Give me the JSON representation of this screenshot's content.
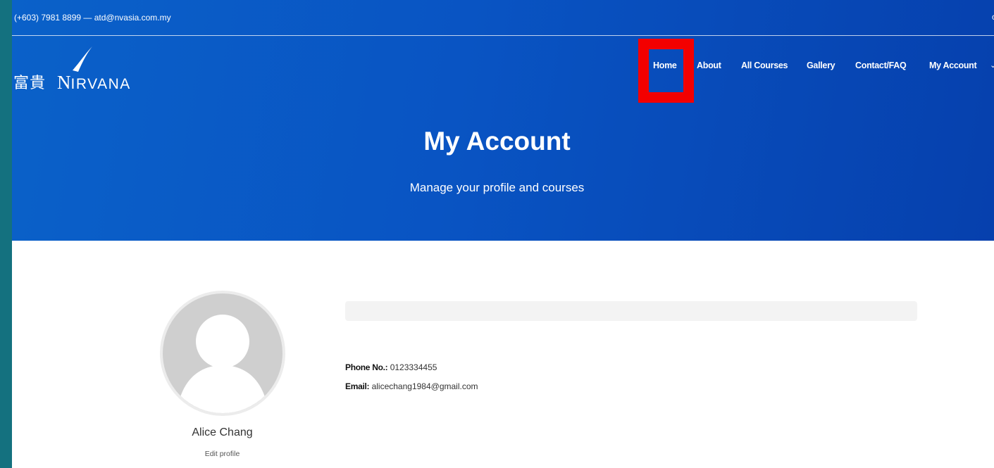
{
  "topbar": {
    "contact": "(+603) 7981 8899 — atd@nvasia.com.my"
  },
  "logo": {
    "cjk_text": "富貴",
    "initial": "N",
    "word_rest": "IRVANA"
  },
  "nav": {
    "items": [
      {
        "label": "Home"
      },
      {
        "label": "About"
      },
      {
        "label": "All Courses"
      },
      {
        "label": "Gallery"
      },
      {
        "label": "Contact/FAQ"
      },
      {
        "label": "My Account"
      }
    ]
  },
  "hero": {
    "title": "My Account",
    "subtitle": "Manage your profile and courses"
  },
  "profile": {
    "name": "Alice Chang",
    "edit_label": "Edit profile",
    "phone_label": "Phone No.:",
    "phone_value": "0123334455",
    "email_label": "Email:",
    "email_value": "alicechang1984@gmail.com"
  },
  "colors": {
    "hero_blue": "#0954c3",
    "highlight_red": "#f30000",
    "side_teal": "#14717f"
  }
}
